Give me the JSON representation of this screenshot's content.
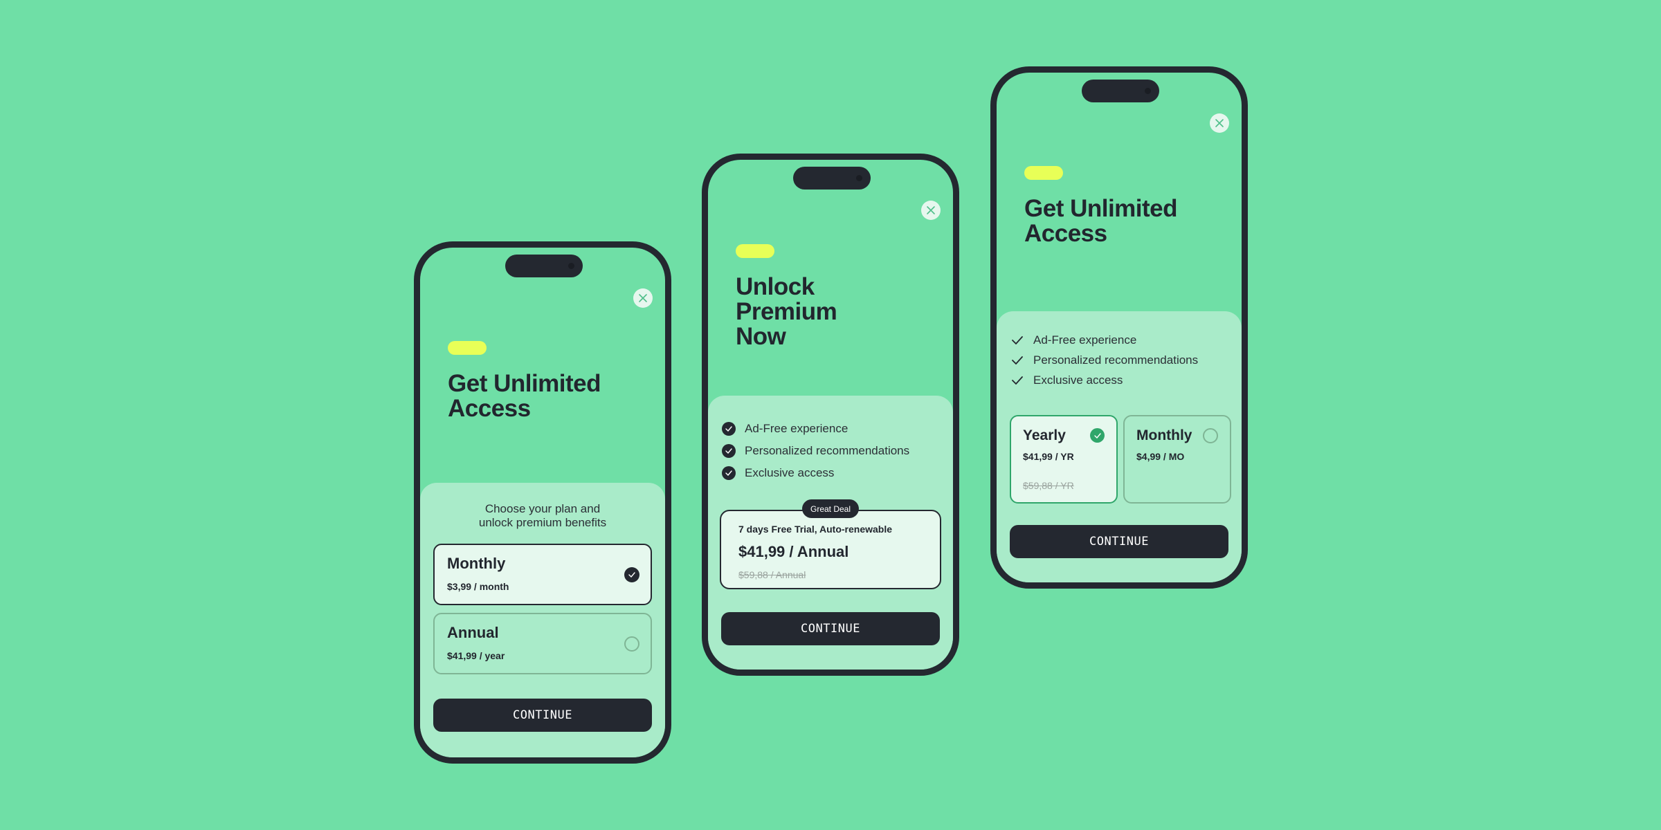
{
  "colors": {
    "background": "#6fdfa6",
    "sheet": "#a9ebc9",
    "dark": "#242830",
    "accent_pill": "#e8ff57",
    "selected_card": "#e6f8ee",
    "success_green": "#2fa66a"
  },
  "phones": [
    {
      "variant": "plan-list",
      "title_lines": [
        "Get Unlimited",
        "Access"
      ],
      "close_icon": "close-icon",
      "subtitle_lines": [
        "Choose your plan and",
        "unlock premium benefits"
      ],
      "plans": [
        {
          "name": "Monthly",
          "price": "$3,99 / month",
          "selected": true
        },
        {
          "name": "Annual",
          "price": "$41,99 / year",
          "selected": false
        }
      ],
      "continue_label": "CONTINUE"
    },
    {
      "variant": "great-deal",
      "title_lines": [
        "Unlock",
        "Premium",
        "Now"
      ],
      "close_icon": "close-icon",
      "features": [
        "Ad-Free experience",
        "Personalized recommendations",
        "Exclusive access"
      ],
      "deal": {
        "badge": "Great Deal",
        "trial": "7 days Free Trial, Auto-renewable",
        "price": "$41,99 / Annual",
        "old_price": "$59,88 / Annual"
      },
      "continue_label": "CONTINUE"
    },
    {
      "variant": "side-by-side",
      "title_lines": [
        "Get Unlimited",
        "Access"
      ],
      "close_icon": "close-icon",
      "features": [
        "Ad-Free experience",
        "Personalized recommendations",
        "Exclusive access"
      ],
      "plans": [
        {
          "name": "Yearly",
          "price": "$41,99 / YR",
          "old_price": "$59,88 / YR",
          "selected": true
        },
        {
          "name": "Monthly",
          "price": "$4,99 / MO",
          "selected": false
        }
      ],
      "continue_label": "CONTINUE"
    }
  ]
}
